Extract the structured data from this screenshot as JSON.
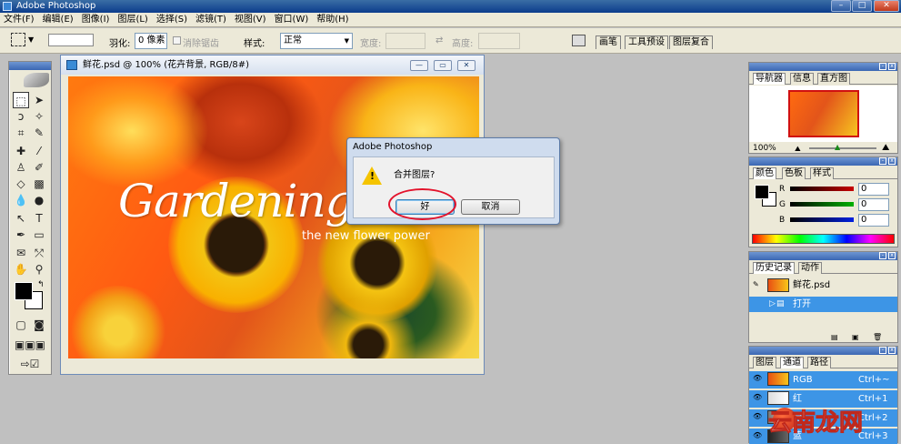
{
  "window": {
    "title": "Adobe Photoshop",
    "minimize": "–",
    "maximize": "□",
    "close": "✕"
  },
  "menu": [
    "文件(F)",
    "编辑(E)",
    "图像(I)",
    "图层(L)",
    "选择(S)",
    "滤镜(T)",
    "视图(V)",
    "窗口(W)",
    "帮助(H)"
  ],
  "options": {
    "feather_label": "羽化:",
    "feather_value": "0 像素",
    "antialias_label": "消除锯齿",
    "style_label": "样式:",
    "style_value": "正常",
    "width_label": "宽度:",
    "height_label": "高度:",
    "tabs": [
      "画笔",
      "工具预设",
      "图层复合"
    ]
  },
  "document": {
    "title": "鲜花.psd @ 100% (花卉背景, RGB/8#)",
    "art_title": "Gardening C",
    "art_subtitle": "the new flower power"
  },
  "dialog": {
    "title": "Adobe Photoshop",
    "message": "合并图层?",
    "ok": "好",
    "cancel": "取消"
  },
  "navigator": {
    "tabs": [
      "导航器",
      "信息",
      "直方图"
    ],
    "zoom": "100%"
  },
  "color": {
    "tabs": [
      "颜色",
      "色板",
      "样式"
    ],
    "channels": [
      {
        "label": "R",
        "value": "0",
        "color": "#d01010"
      },
      {
        "label": "G",
        "value": "0",
        "color": "#10a010"
      },
      {
        "label": "B",
        "value": "0",
        "color": "#1030d0"
      }
    ]
  },
  "history": {
    "tabs": [
      "历史记录",
      "动作"
    ],
    "snapshot": "鲜花.psd",
    "items": [
      "打开"
    ]
  },
  "channels": {
    "tabs": [
      "图层",
      "通道",
      "路径"
    ],
    "rows": [
      {
        "name": "RGB",
        "shortcut": "Ctrl+~"
      },
      {
        "name": "红",
        "shortcut": "Ctrl+1"
      },
      {
        "name": "绿",
        "shortcut": "Ctrl+2"
      },
      {
        "name": "蓝",
        "shortcut": "Ctrl+3"
      }
    ]
  },
  "watermark": "云南龙网"
}
